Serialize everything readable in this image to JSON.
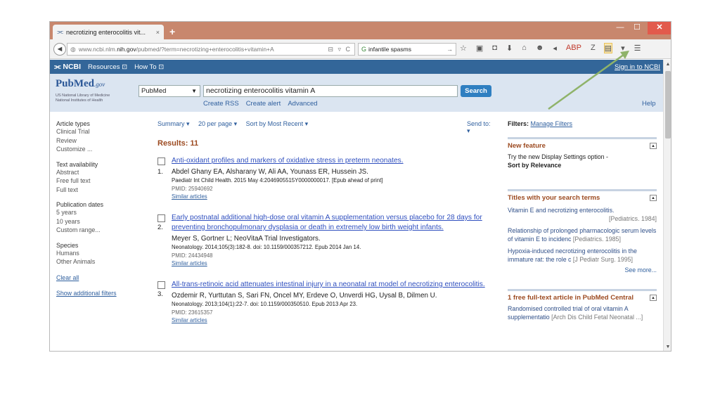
{
  "browser": {
    "tab_title": "necrotizing enterocolitis vit...",
    "tab_close": "×",
    "new_tab": "+",
    "win_min": "—",
    "win_max": "☐",
    "win_close": "✕",
    "url_prefix": "www.ncbi.nlm.",
    "url_host": "nih.gov",
    "url_rest": "/pubmed/?term=necrotizing+enterocolitis+vitamin+A",
    "url_icons": "⊟ ▿ C",
    "search_value": "infantile spasms",
    "search_go": "→",
    "toolbar_icons": [
      "☆",
      "▣",
      "◘",
      "⬇",
      "⌂",
      "☻",
      "◂",
      "ABP",
      "Z",
      "▤",
      "▾",
      "☰"
    ]
  },
  "ncbi": {
    "logo": "⫘ NCBI",
    "resources": "Resources ⊡",
    "howto": "How To ⊡",
    "signin": "Sign in to NCBI"
  },
  "pubmed": {
    "logo_main": "PubMed",
    "logo_gov": ".gov",
    "library_line1": "US National Library of Medicine",
    "library_line2": "National Institutes of Health",
    "db_select": "PubMed",
    "query": "necrotizing enterocolitis vitamin A",
    "search_button": "Search",
    "create_rss": "Create RSS",
    "create_alert": "Create alert",
    "advanced": "Advanced",
    "help": "Help"
  },
  "filters_left": {
    "article_types": {
      "header": "Article types",
      "items": [
        "Clinical Trial",
        "Review",
        "Customize ..."
      ]
    },
    "text_availability": {
      "header": "Text availability",
      "items": [
        "Abstract",
        "Free full text",
        "Full text"
      ]
    },
    "publication_dates": {
      "header": "Publication dates",
      "items": [
        "5 years",
        "10 years",
        "Custom range..."
      ]
    },
    "species": {
      "header": "Species",
      "items": [
        "Humans",
        "Other Animals"
      ]
    },
    "clear_all": "Clear all",
    "show_additional": "Show additional filters"
  },
  "results": {
    "summary": "Summary ▾",
    "per_page": "20 per page ▾",
    "sort": "Sort by Most Recent ▾",
    "send_to": "Send to: ▾",
    "count": "Results: 11",
    "items": [
      {
        "num": "1.",
        "title": "Anti-oxidant profiles and markers of oxidative stress in preterm neonates.",
        "authors": "Abdel Ghany EA, Alsharany W, Ali AA, Younass ER, Hussein JS.",
        "journal": "Paediatr Int Child Health. 2015 May 4:2046905515Y0000000017. [Epub ahead of print]",
        "pmid": "PMID: 25940692",
        "similar": "Similar articles"
      },
      {
        "num": "2.",
        "title": "Early postnatal additional high-dose oral vitamin A supplementation versus placebo for 28 days for preventing bronchopulmonary dysplasia or death in extremely low birth weight infants.",
        "authors": "Meyer S, Gortner L; NeoVitaA Trial Investigators.",
        "journal": "Neonatology. 2014;105(3):182-8. doi: 10.1159/000357212. Epub 2014 Jan 14.",
        "pmid": "PMID: 24434948",
        "similar": "Similar articles"
      },
      {
        "num": "3.",
        "title": "All-trans-retinoic acid attenuates intestinal injury in a neonatal rat model of necrotizing enterocolitis.",
        "authors": "Ozdemir R, Yurttutan S, Sari FN, Oncel MY, Erdeve O, Unverdi HG, Uysal B, Dilmen U.",
        "journal": "Neonatology. 2013;104(1):22-7. doi: 10.1159/000350510. Epub 2013 Apr 23.",
        "pmid": "PMID: 23615357",
        "similar": "Similar articles"
      }
    ]
  },
  "right_panel": {
    "filters_label": "Filters:",
    "manage_filters": "Manage Filters",
    "new_feature": {
      "header": "New feature",
      "text": "Try the new Display Settings option -",
      "bold": "Sort by Relevance"
    },
    "titles_terms": {
      "header": "Titles with your search terms",
      "items": [
        {
          "text": "Vitamin E and necrotizing enterocolitis.",
          "src": "[Pediatrics. 1984]"
        },
        {
          "text": "Relationship of prolonged pharmacologic serum levels of vitamin E to incidenc",
          "src": "[Pediatrics. 1985]"
        },
        {
          "text": "Hypoxia-induced necrotizing enterocolitis in the immature rat: the role c",
          "src": "[J Pediatr Surg. 1995]"
        }
      ],
      "see_more": "See more..."
    },
    "free_fulltext": {
      "header": "1 free full-text article in PubMed Central",
      "text": "Randomised controlled trial of oral vitamin A supplementatio",
      "src": "[Arch Dis Child Fetal Neonatal ...]"
    },
    "collapse_glyph": "▲"
  },
  "scrollbar": {
    "up": "▲",
    "down": "▼"
  },
  "colors": {
    "ncbi_bar": "#336699",
    "pubmed_bg": "#dbe5f1",
    "title_bar": "#c8876d",
    "link": "#2f4fbf",
    "results_count": "#9c4a20",
    "annotation_arrow": "#8fb36a"
  }
}
